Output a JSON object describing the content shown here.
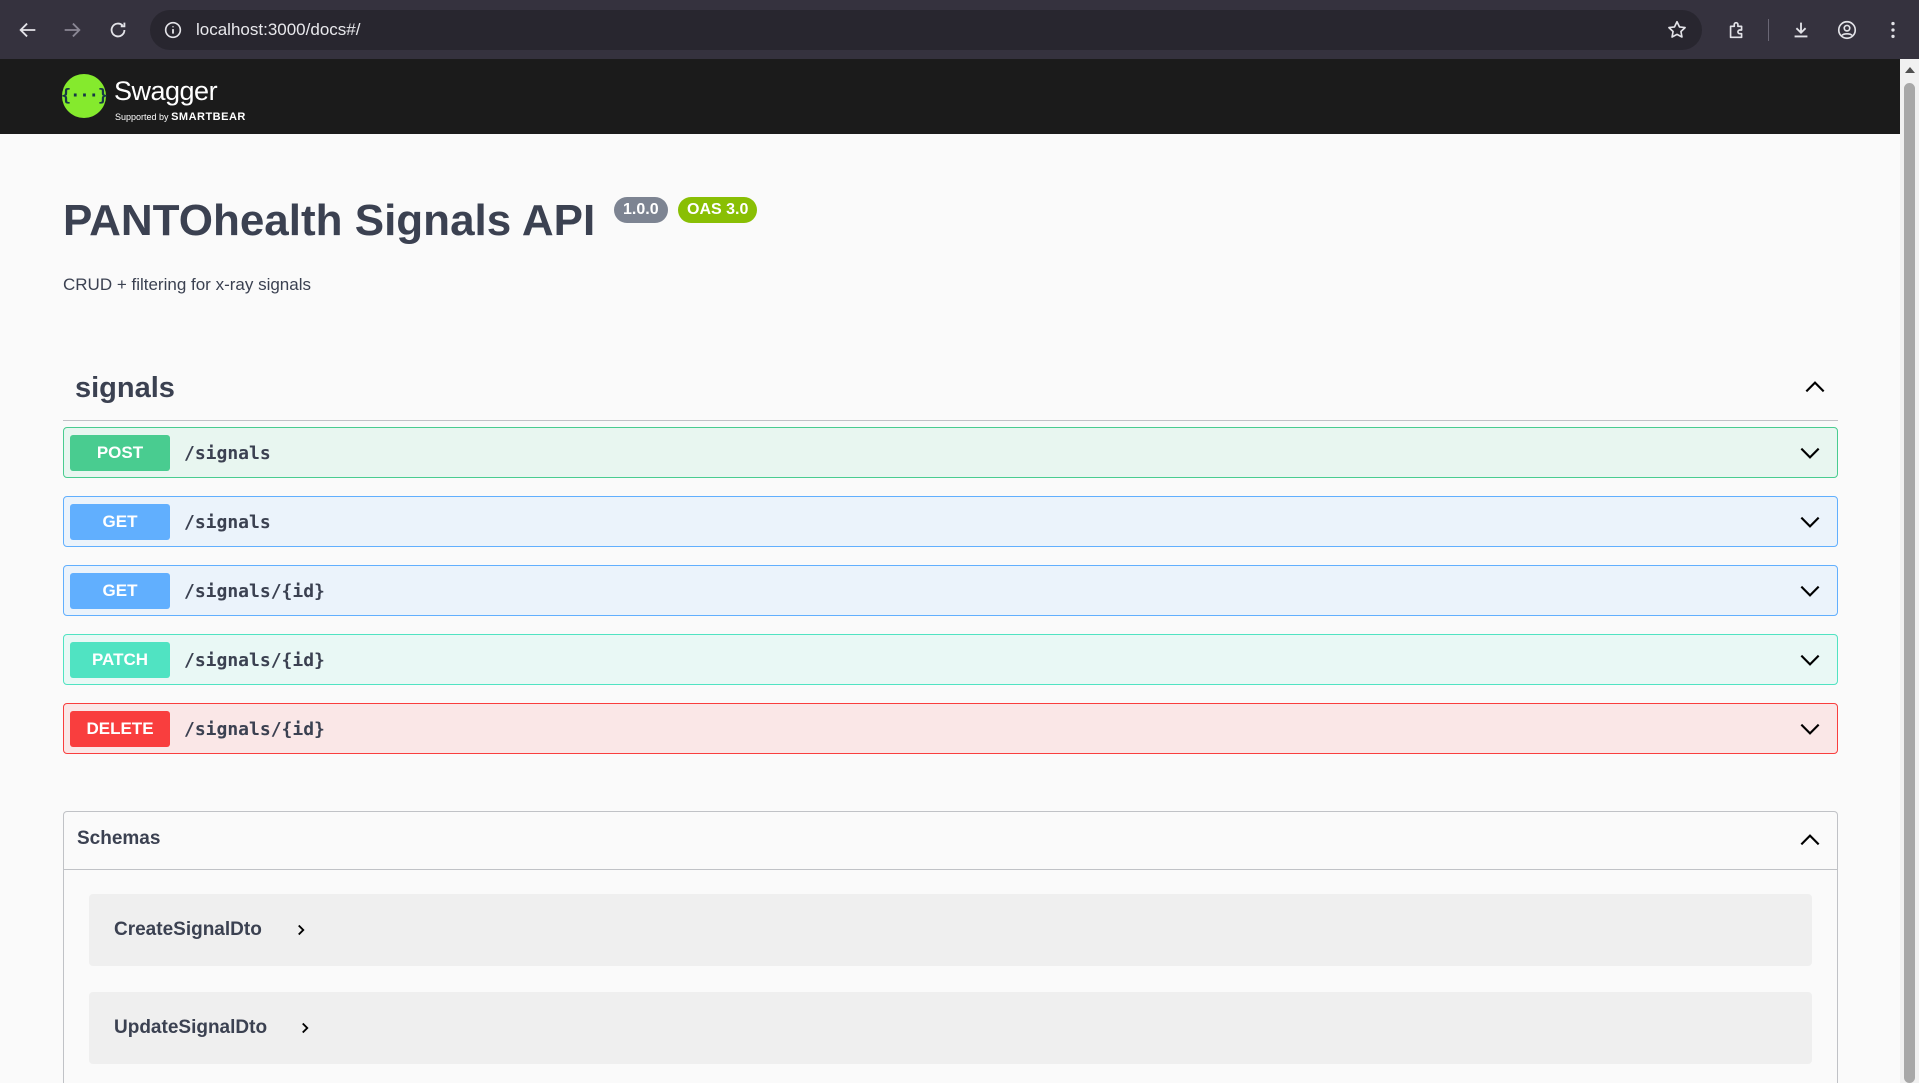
{
  "browser": {
    "url": "localhost:3000/docs#/"
  },
  "topbar": {
    "logo_text": "Swagger",
    "logo_sub_prefix": "Supported by",
    "logo_sub_brand": "SMARTBEAR"
  },
  "info": {
    "title": "PANTOhealth Signals API",
    "version": "1.0.0",
    "oas_version": "OAS 3.0",
    "description": "CRUD + filtering for x-ray signals"
  },
  "tag": {
    "name": "signals"
  },
  "operations": [
    {
      "method": "POST",
      "path": "/signals"
    },
    {
      "method": "GET",
      "path": "/signals"
    },
    {
      "method": "GET",
      "path": "/signals/{id}"
    },
    {
      "method": "PATCH",
      "path": "/signals/{id}"
    },
    {
      "method": "DELETE",
      "path": "/signals/{id}"
    }
  ],
  "schemas": {
    "title": "Schemas",
    "models": [
      "CreateSignalDto",
      "UpdateSignalDto"
    ]
  },
  "colors": {
    "post": "#49cc90",
    "get": "#61affe",
    "patch": "#50e3c2",
    "delete": "#f93e3e",
    "swagger_green": "#85ea2d"
  }
}
